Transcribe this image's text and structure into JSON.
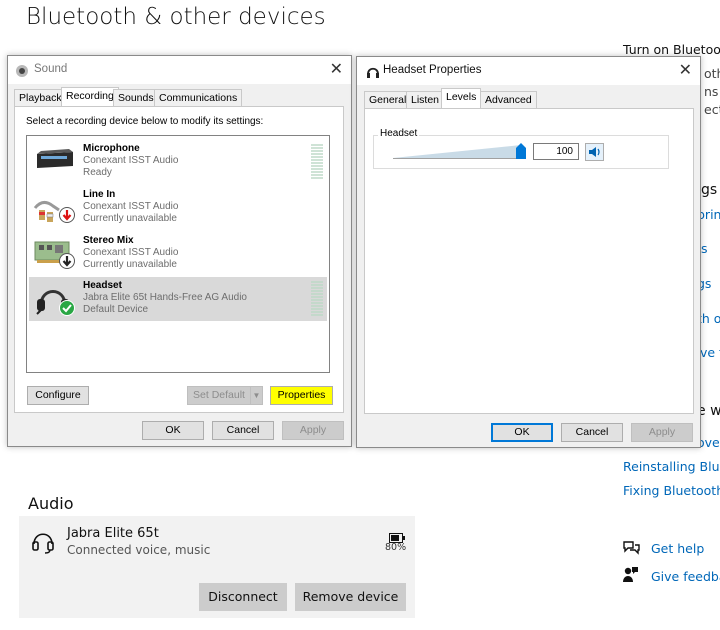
{
  "page_title": "Bluetooth & other devices",
  "right_panel": {
    "turn_on": "Turn on Bluetooth",
    "frag1": "oth",
    "frag2": "ns",
    "frag3": "ect",
    "related": "gs",
    "link1": "print",
    "link2": "s",
    "link3": "gs",
    "link4": "th o",
    "link5": "ve f",
    "help_web": "e we",
    "link6": "over",
    "reinstall": "Reinstalling Bluet",
    "fixing": "Fixing Bluetooth",
    "get_help": "Get help",
    "give_feedback": "Give feedback"
  },
  "sound_dialog": {
    "title": "Sound",
    "close": "✕",
    "tabs": [
      "Playback",
      "Recording",
      "Sounds",
      "Communications"
    ],
    "instruction": "Select a recording device below to modify its settings:",
    "devices": [
      {
        "name": "Microphone",
        "driver": "Conexant ISST Audio",
        "status": "Ready"
      },
      {
        "name": "Line In",
        "driver": "Conexant ISST Audio",
        "status": "Currently unavailable"
      },
      {
        "name": "Stereo Mix",
        "driver": "Conexant ISST Audio",
        "status": "Currently unavailable"
      },
      {
        "name": "Headset",
        "driver": "Jabra Elite 65t Hands-Free AG Audio",
        "status": "Default Device"
      }
    ],
    "configure": "Configure",
    "set_default": "Set Default",
    "properties": "Properties",
    "ok": "OK",
    "cancel": "Cancel",
    "apply": "Apply"
  },
  "headset_dialog": {
    "title": "Headset Properties",
    "close": "✕",
    "tabs": [
      "General",
      "Listen",
      "Levels",
      "Advanced"
    ],
    "group_label": "Headset",
    "level_value": "100",
    "level_fraction": 1.0,
    "ok": "OK",
    "cancel": "Cancel",
    "apply": "Apply"
  },
  "audio": {
    "heading": "Audio",
    "device_name": "Jabra Elite 65t",
    "device_status": "Connected voice, music",
    "battery": "80%",
    "disconnect": "Disconnect",
    "remove": "Remove device"
  },
  "colors": {
    "highlight": "#ffff00",
    "link": "#0067b8",
    "accent": "#0078d7",
    "default_check": "#2aa745"
  }
}
